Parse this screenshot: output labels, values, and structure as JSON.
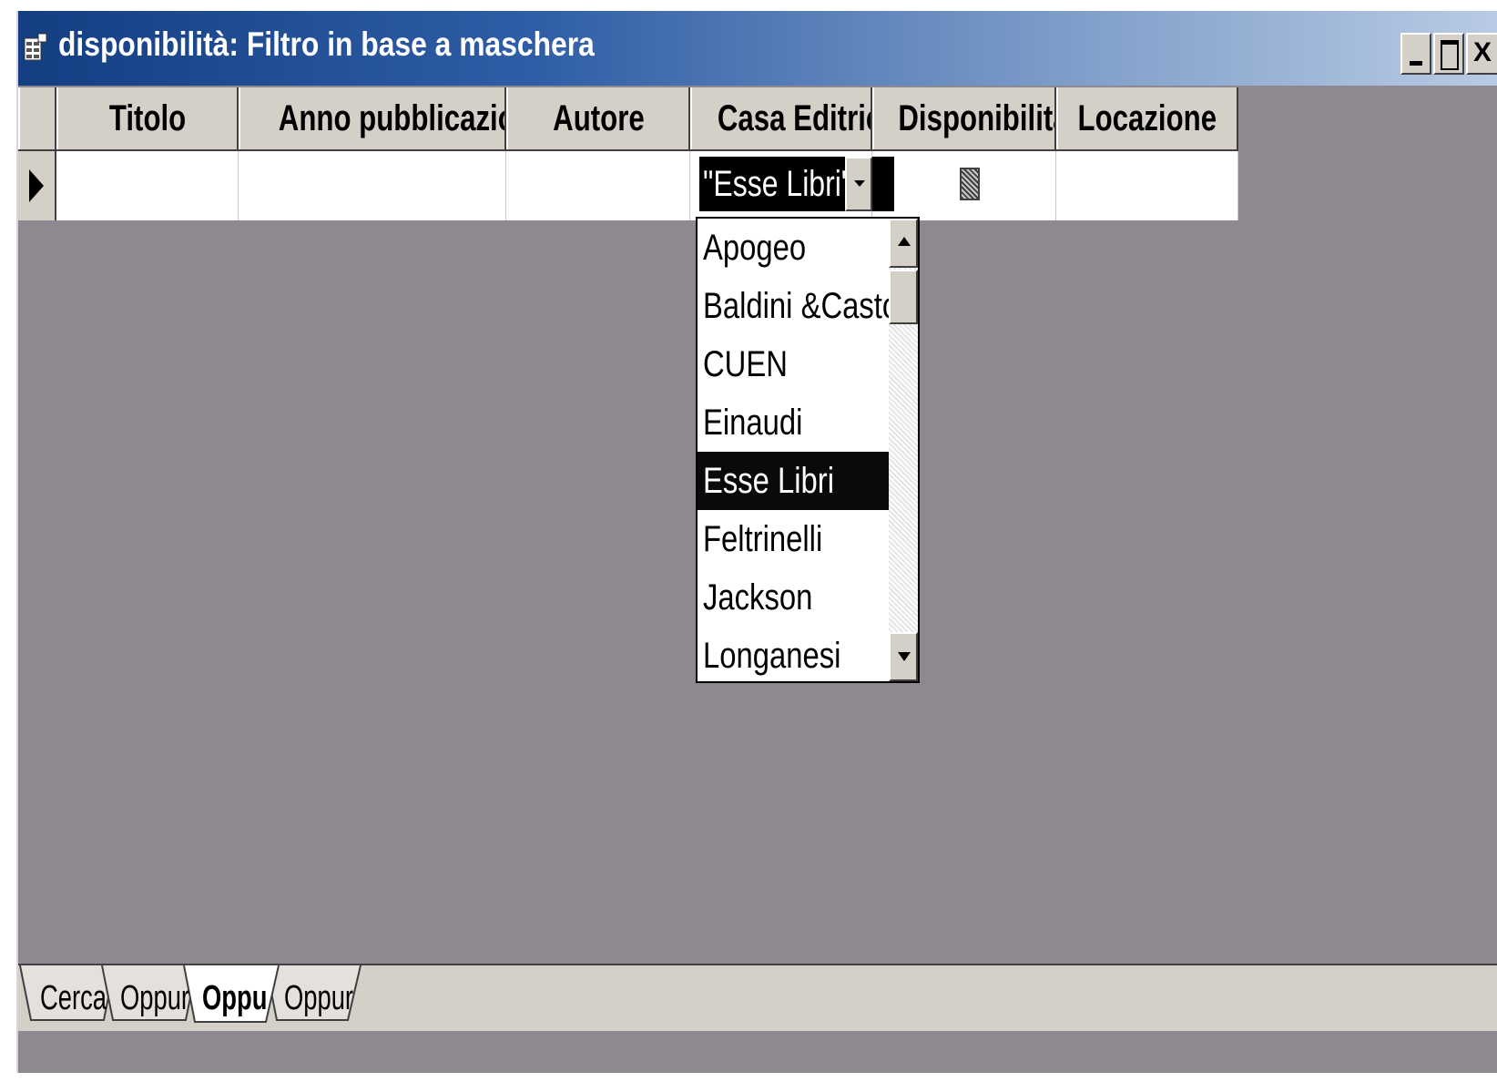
{
  "window": {
    "title": "disponibilità: Filtro in base a maschera",
    "close_label": "X"
  },
  "grid": {
    "columns": [
      "Titolo",
      "Anno pubblicazione",
      "Autore",
      "Casa Editrice",
      "Disponibilità",
      "Locazione"
    ],
    "filter_row": {
      "casa_editrice": "\"Esse Libri\""
    }
  },
  "dropdown": {
    "items": [
      "Apogeo",
      "Baldini &Castold",
      "CUEN",
      "Einaudi",
      "Esse Libri",
      "Feltrinelli",
      "Jackson",
      "Longanesi"
    ],
    "selected": "Esse Libri"
  },
  "tabs": [
    "Cerca",
    "Oppur",
    "Oppu",
    "Oppur"
  ],
  "active_tab": "Oppu",
  "colors": {
    "title_gradient_start": "#143e82",
    "workspace": "#8e8890",
    "selection": "#0a0a0a"
  }
}
